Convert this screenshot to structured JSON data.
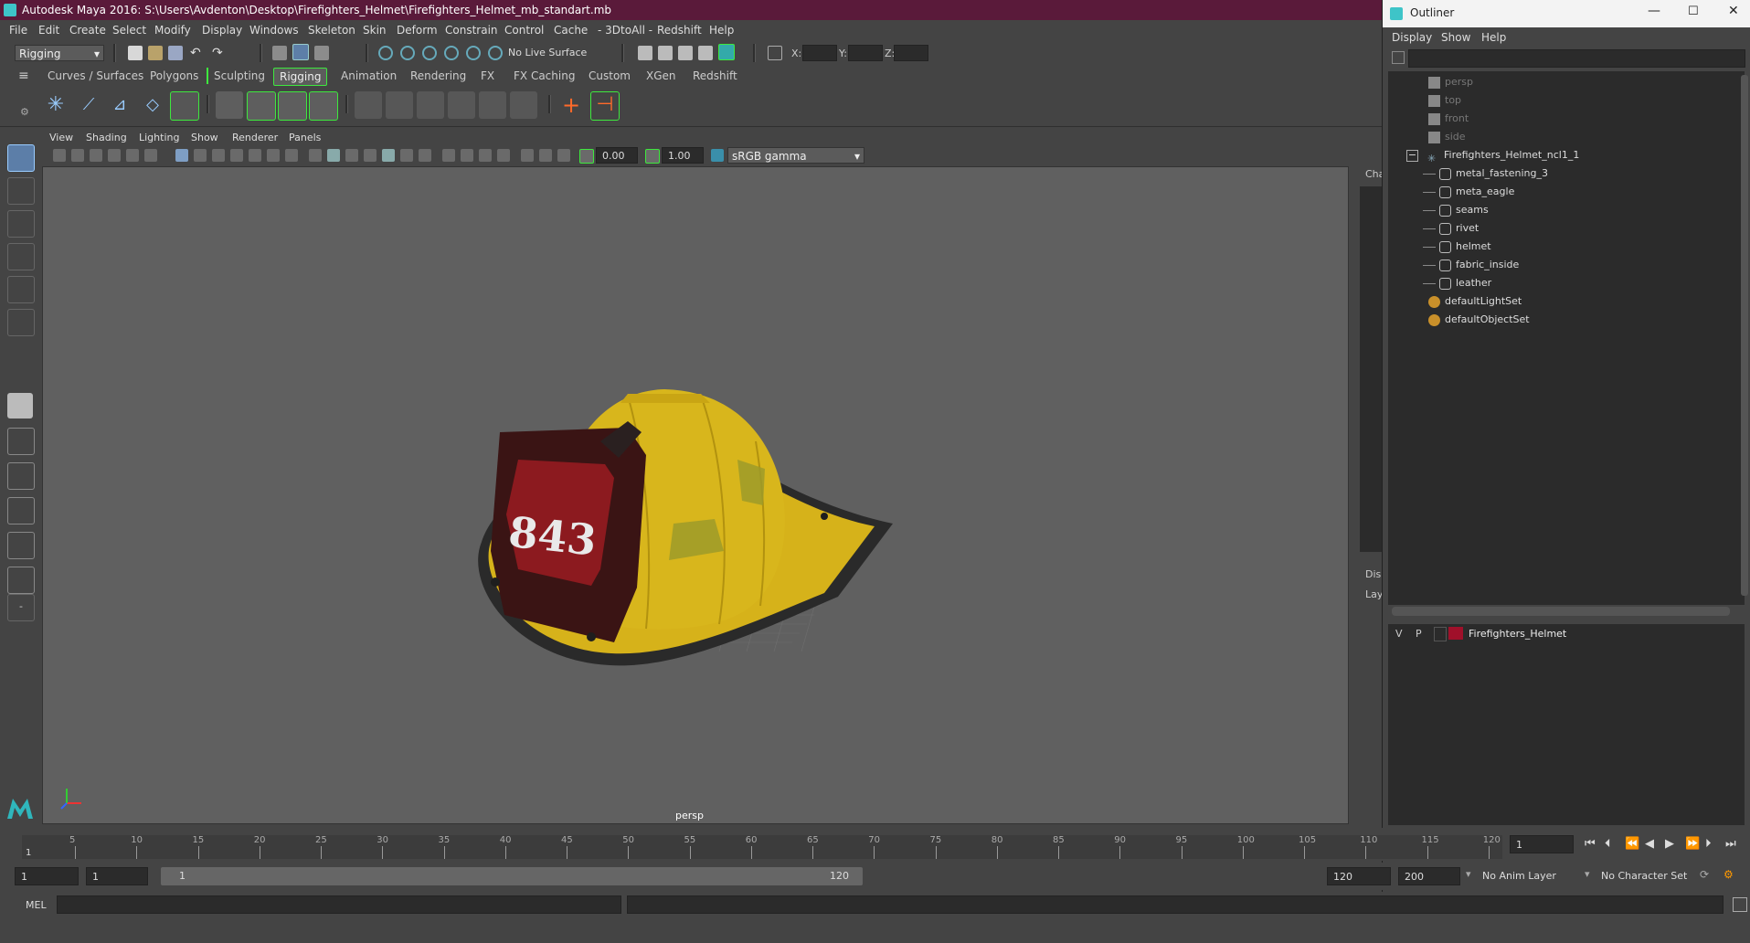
{
  "window": {
    "title": "Autodesk Maya 2016: S:\\Users\\Avdenton\\Desktop\\Firefighters_Helmet\\Firefighters_Helmet_mb_standart.mb"
  },
  "menubar": [
    "File",
    "Edit",
    "Create",
    "Select",
    "Modify",
    "Display",
    "Windows",
    "Skeleton",
    "Skin",
    "Deform",
    "Constrain",
    "Control",
    "Cache",
    "- 3DtoAll -",
    "Redshift",
    "Help"
  ],
  "toolbar": {
    "mode": "Rigging",
    "live_surface": "No Live Surface",
    "x_label": "X:",
    "y_label": "Y:",
    "z_label": "Z:"
  },
  "shelf_tabs": [
    "Curves / Surfaces",
    "Polygons",
    "Sculpting",
    "Rigging",
    "Animation",
    "Rendering",
    "FX",
    "FX Caching",
    "Custom",
    "XGen",
    "Redshift"
  ],
  "shelf_active": "Rigging",
  "panel_menu": [
    "View",
    "Shading",
    "Lighting",
    "Show",
    "Renderer",
    "Panels"
  ],
  "panel_toolbar": {
    "exposure": "0.00",
    "gamma": "1.00",
    "color_space": "sRGB gamma"
  },
  "viewport": {
    "camera_label": "persp",
    "decal_text": "843"
  },
  "side_tabs": {
    "channel": "Cha",
    "display": "Dis",
    "layers": "Lay"
  },
  "outliner": {
    "title": "Outliner",
    "menu": [
      "Display",
      "Show",
      "Help"
    ],
    "items": [
      {
        "label": "persp",
        "type": "camera",
        "level": 1,
        "dim": true
      },
      {
        "label": "top",
        "type": "camera",
        "level": 1,
        "dim": true
      },
      {
        "label": "front",
        "type": "camera",
        "level": 1,
        "dim": true
      },
      {
        "label": "side",
        "type": "camera",
        "level": 1,
        "dim": true
      },
      {
        "label": "Firefighters_Helmet_ncl1_1",
        "type": "group",
        "level": 1,
        "dim": false
      },
      {
        "label": "metal_fastening_3",
        "type": "mesh",
        "level": 2,
        "dim": false
      },
      {
        "label": "meta_eagle",
        "type": "mesh",
        "level": 2,
        "dim": false
      },
      {
        "label": "seams",
        "type": "mesh",
        "level": 2,
        "dim": false
      },
      {
        "label": "rivet",
        "type": "mesh",
        "level": 2,
        "dim": false
      },
      {
        "label": "helmet",
        "type": "mesh",
        "level": 2,
        "dim": false
      },
      {
        "label": "fabric_inside",
        "type": "mesh",
        "level": 2,
        "dim": false
      },
      {
        "label": "leather",
        "type": "mesh",
        "level": 2,
        "dim": false
      },
      {
        "label": "defaultLightSet",
        "type": "set",
        "level": 1,
        "dim": false
      },
      {
        "label": "defaultObjectSet",
        "type": "set",
        "level": 1,
        "dim": false
      }
    ]
  },
  "layers": {
    "v": "V",
    "p": "P",
    "name": "Firefighters_Helmet",
    "color": "#a0102a"
  },
  "timeline": {
    "ticks": [
      "5",
      "10",
      "15",
      "20",
      "25",
      "30",
      "35",
      "40",
      "45",
      "50",
      "55",
      "60",
      "65",
      "70",
      "75",
      "80",
      "85",
      "90",
      "95",
      "100",
      "105",
      "110",
      "115",
      "120"
    ],
    "start_mark": "1",
    "current_frame": "1"
  },
  "range": {
    "start": "1",
    "playback_start": "1",
    "range_start": "1",
    "range_end": "120",
    "playback_end": "120",
    "end": "200",
    "anim_layer": "No Anim Layer",
    "character_set": "No Character Set"
  },
  "cmdline": {
    "label": "MEL"
  },
  "colors": {
    "accent_green": "#3ee83e",
    "helmet_yellow": "#d6b21a",
    "maya_teal": "#3ec4c8",
    "title_bar": "#5a1a3a"
  }
}
